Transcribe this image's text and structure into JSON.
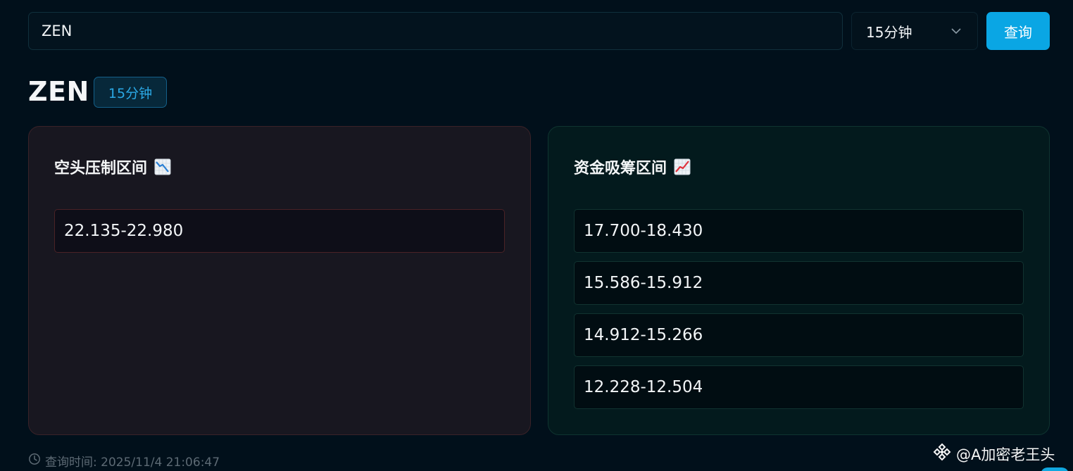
{
  "search": {
    "value": "ZEN"
  },
  "interval_select": {
    "selected": "15分钟"
  },
  "query_button": {
    "label": "查询"
  },
  "header": {
    "symbol": "ZEN",
    "interval_tag": "15分钟"
  },
  "short_panel": {
    "title": "空头压制区间",
    "icon": "chart-decreasing-icon",
    "zones": [
      "22.135-22.980"
    ]
  },
  "long_panel": {
    "title": "资金吸筹区间",
    "icon": "chart-increasing-icon",
    "zones": [
      "17.700-18.430",
      "15.586-15.912",
      "14.912-15.266",
      "12.228-12.504"
    ]
  },
  "footer": {
    "query_time": "查询时间: 2025/11/4 21:06:47"
  },
  "watermark": {
    "text": "@A加密老王头"
  },
  "colors": {
    "background": "#01101b",
    "accent": "#0aa6e4",
    "short_border": "#4a2226",
    "long_border": "#113330"
  }
}
